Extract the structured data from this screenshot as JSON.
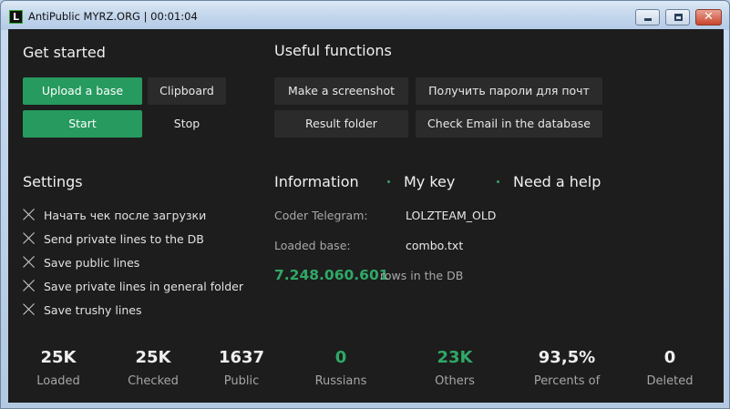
{
  "window": {
    "title": "AntiPublic MYRZ.ORG | 00:01:04",
    "icon": "L",
    "close_glyph": "✕"
  },
  "get_started": {
    "heading": "Get started",
    "upload_base": "Upload a base",
    "clipboard": "Clipboard",
    "start": "Start",
    "stop": "Stop"
  },
  "useful": {
    "heading": "Useful functions",
    "screenshot": "Make a screenshot",
    "get_passwords": "Получить пароли для почт",
    "result_folder": "Result folder",
    "check_email": "Check Email in the database"
  },
  "settings": {
    "heading": "Settings",
    "items": [
      "Начать чек после загрузки",
      "Send private lines to the DB",
      "Save public lines",
      "Save private lines in general folder",
      "Save trushy lines"
    ]
  },
  "info_tabs": {
    "information": "Information",
    "my_key": "My key",
    "need_help": "Need a help"
  },
  "information": {
    "coder_label": "Coder Telegram:",
    "coder_value": "LOLZTEAM_OLD",
    "base_label": "Loaded base:",
    "base_value": "combo.txt",
    "rows_count": "7.248.060.601",
    "rows_label": "rows in the DB"
  },
  "stats": [
    {
      "value": "25K",
      "label": "Loaded"
    },
    {
      "value": "25K",
      "label": "Checked"
    },
    {
      "value": "1637",
      "label": "Public"
    },
    {
      "value": "0",
      "label": "Russians"
    },
    {
      "value": "23K",
      "label": "Others"
    },
    {
      "value": "93,5%",
      "label": "Percents of"
    },
    {
      "value": "0",
      "label": "Deleted"
    }
  ],
  "colors": {
    "accent": "#279a5f",
    "background": "#1d1d1d",
    "button": "#2b2b2b"
  }
}
